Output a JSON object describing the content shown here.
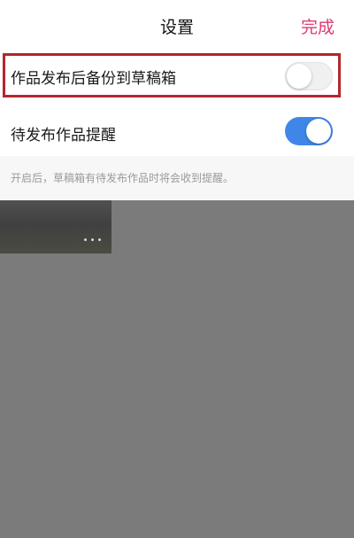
{
  "header": {
    "title": "设置",
    "done_label": "完成"
  },
  "settings": [
    {
      "label": "作品发布后备份到草稿箱",
      "enabled": false,
      "highlighted": true
    },
    {
      "label": "待发布作品提醒",
      "enabled": true,
      "highlighted": false
    }
  ],
  "hint": "开启后，草稿箱有待发布作品时将会收到提醒。",
  "thumbnail": {
    "menu_icon": "more-dots-icon"
  },
  "colors": {
    "accent": "#e0396e",
    "toggle_on": "#3f86e8",
    "highlight_border": "#b4262c",
    "overlay": "#7b7b7b"
  }
}
